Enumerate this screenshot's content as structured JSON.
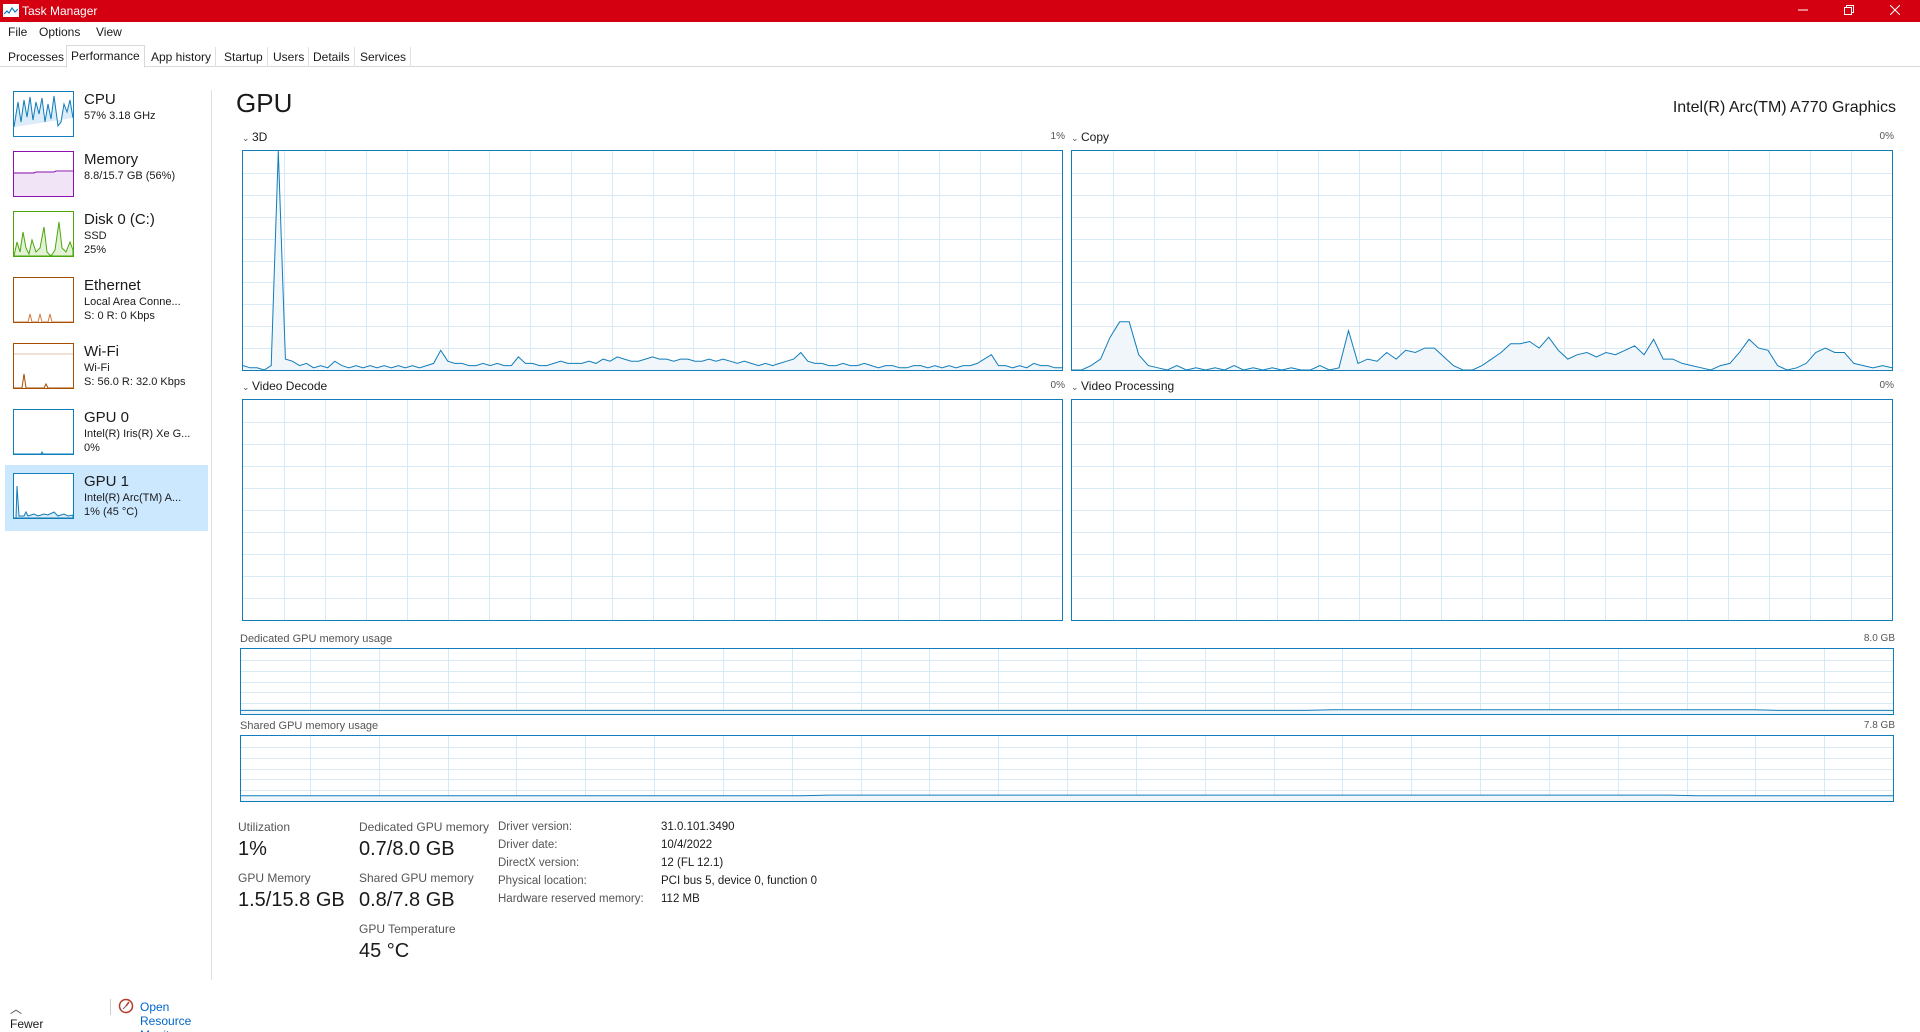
{
  "window": {
    "title": "Task Manager",
    "controls": {
      "minimize": "–",
      "restore": "❐",
      "close": "✕"
    }
  },
  "menu": [
    "File",
    "Options",
    "View"
  ],
  "tabs": [
    "Processes",
    "Performance",
    "App history",
    "Startup",
    "Users",
    "Details",
    "Services"
  ],
  "active_tab": "Performance",
  "sidebar": {
    "items": [
      {
        "name": "CPU",
        "line1": "57% 3.18 GHz",
        "line2": "",
        "line3": "",
        "color": "#117dbb"
      },
      {
        "name": "Memory",
        "line1": "8.8/15.7 GB (56%)",
        "line2": "",
        "line3": "",
        "color": "#8b12ae"
      },
      {
        "name": "Disk 0 (C:)",
        "line1": "SSD",
        "line2": "25%",
        "line3": "",
        "color": "#4da60c"
      },
      {
        "name": "Ethernet",
        "line1": "Local Area Conne...",
        "line2": "S: 0 R: 0 Kbps",
        "line3": "",
        "color": "#a74f01"
      },
      {
        "name": "Wi-Fi",
        "line1": "Wi-Fi",
        "line2": "S: 56.0 R: 32.0 Kbps",
        "line3": "",
        "color": "#a74f01"
      },
      {
        "name": "GPU 0",
        "line1": "Intel(R) Iris(R) Xe G...",
        "line2": "0%",
        "line3": "",
        "color": "#117dbb"
      },
      {
        "name": "GPU 1",
        "line1": "Intel(R) Arc(TM) A...",
        "line2": "1% (45 °C)",
        "line3": "",
        "color": "#117dbb"
      }
    ],
    "selected_index": 6
  },
  "main": {
    "title": "GPU",
    "device": "Intel(R) Arc(TM) A770 Graphics",
    "engines": [
      {
        "label": "3D",
        "percent": "1%"
      },
      {
        "label": "Copy",
        "percent": "0%"
      },
      {
        "label": "Video Decode",
        "percent": "0%"
      },
      {
        "label": "Video Processing",
        "percent": "0%"
      }
    ],
    "memory_graphs": {
      "dedicated": {
        "label": "Dedicated GPU memory usage",
        "max": "8.0 GB"
      },
      "shared": {
        "label": "Shared GPU memory usage",
        "max": "7.8 GB"
      }
    },
    "stats": {
      "utilization": {
        "label": "Utilization",
        "value": "1%"
      },
      "gpu_memory": {
        "label": "GPU Memory",
        "value": "1.5/15.8 GB"
      },
      "dedicated_memory": {
        "label": "Dedicated GPU memory",
        "value": "0.7/8.0 GB"
      },
      "shared_memory": {
        "label": "Shared GPU memory",
        "value": "0.8/7.8 GB"
      },
      "temperature": {
        "label": "GPU Temperature",
        "value": "45 °C"
      }
    },
    "info": [
      {
        "key": "Driver version:",
        "value": "31.0.101.3490"
      },
      {
        "key": "Driver date:",
        "value": "10/4/2022"
      },
      {
        "key": "DirectX version:",
        "value": "12 (FL 12.1)"
      },
      {
        "key": "Physical location:",
        "value": "PCI bus 5, device 0, function 0"
      },
      {
        "key": "Hardware reserved memory:",
        "value": "112 MB"
      }
    ]
  },
  "footer": {
    "fewer_details": "Fewer details",
    "resource_monitor": "Open Resource Monitor"
  },
  "colors": {
    "titlebar": "#d40012",
    "gpu_line": "#117dbb",
    "grid": "#d9eaf7",
    "selected": "#cce8ff",
    "link": "#0066cc"
  }
}
